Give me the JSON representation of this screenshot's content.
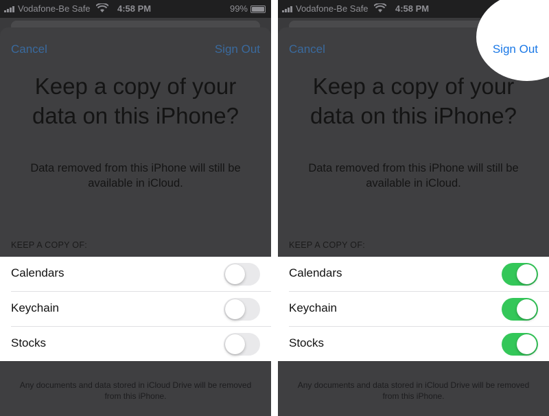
{
  "status_bar": {
    "carrier": "Vodafone-Be Safe",
    "time": "4:58 PM",
    "battery": "99%",
    "battery_level": 0.99
  },
  "colors": {
    "link_blue": "#1a78e6",
    "toggle_on": "#34c759",
    "toggle_off": "#e9e9eb",
    "overlay": "#3f3f41"
  },
  "panels": [
    {
      "cancel_label": "Cancel",
      "sign_out_label": "Sign Out",
      "headline": "Keep a copy of your data on this iPhone?",
      "subtext": "Data removed from this iPhone will still be available in iCloud.",
      "section_header": "KEEP A COPY OF:",
      "items": [
        {
          "label": "Calendars",
          "enabled": false
        },
        {
          "label": "Keychain",
          "enabled": false
        },
        {
          "label": "Stocks",
          "enabled": false
        }
      ],
      "footer": "Any documents and data stored in iCloud Drive will be removed from this iPhone.",
      "highlight_sign_out": false
    },
    {
      "cancel_label": "Cancel",
      "sign_out_label": "Sign Out",
      "headline": "Keep a copy of your data on this iPhone?",
      "subtext": "Data removed from this iPhone will still be available in iCloud.",
      "section_header": "KEEP A COPY OF:",
      "items": [
        {
          "label": "Calendars",
          "enabled": true
        },
        {
          "label": "Keychain",
          "enabled": true
        },
        {
          "label": "Stocks",
          "enabled": true
        }
      ],
      "footer": "Any documents and data stored in iCloud Drive will be removed from this iPhone.",
      "highlight_sign_out": true
    }
  ]
}
